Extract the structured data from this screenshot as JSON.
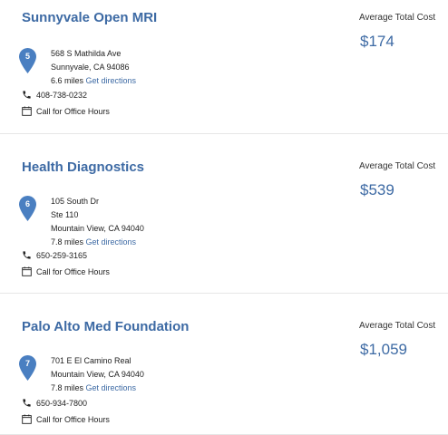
{
  "listings": [
    {
      "name": "Sunnyvale Open MRI",
      "pin_number": "5",
      "address_lines": [
        "568 S Mathilda Ave",
        "Sunnyvale, CA 94086"
      ],
      "distance": "6.6 miles",
      "directions_label": "Get directions",
      "phone": "408-738-0232",
      "hours": "Call for Office Hours",
      "cost_label": "Average Total Cost",
      "cost": "$174"
    },
    {
      "name": "Health Diagnostics",
      "pin_number": "6",
      "address_lines": [
        "105 South Dr",
        "Ste 110",
        "Mountain View, CA 94040"
      ],
      "distance": "7.8 miles",
      "directions_label": "Get directions",
      "phone": "650-259-3165",
      "hours": "Call for Office Hours",
      "cost_label": "Average Total Cost",
      "cost": "$539"
    },
    {
      "name": "Palo Alto Med Foundation",
      "pin_number": "7",
      "address_lines": [
        "701 E El Camino Real",
        "Mountain View, CA 94040"
      ],
      "distance": "7.8 miles",
      "directions_label": "Get directions",
      "phone": "650-934-7800",
      "hours": "Call for Office Hours",
      "cost_label": "Average Total Cost",
      "cost": "$1,059"
    }
  ],
  "icons": {
    "pin": "map-pin-icon",
    "phone": "phone-icon",
    "hours": "calendar-icon"
  },
  "colors": {
    "accent": "#3d6aa4",
    "pin": "#4a7fc1",
    "divider": "#e6e6e6"
  }
}
